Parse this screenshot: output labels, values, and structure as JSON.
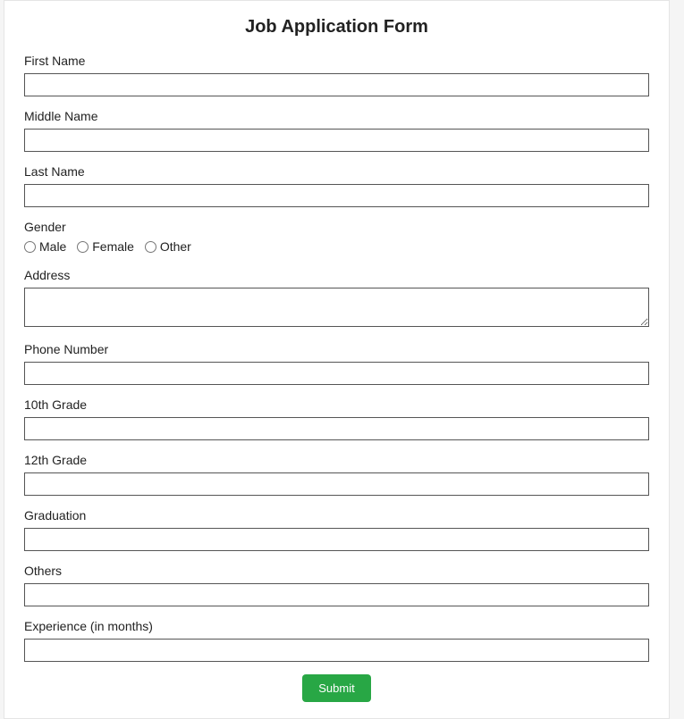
{
  "form": {
    "title": "Job Application Form",
    "firstName": {
      "label": "First Name",
      "value": ""
    },
    "middleName": {
      "label": "Middle Name",
      "value": ""
    },
    "lastName": {
      "label": "Last Name",
      "value": ""
    },
    "gender": {
      "label": "Gender",
      "options": {
        "male": "Male",
        "female": "Female",
        "other": "Other"
      }
    },
    "address": {
      "label": "Address",
      "value": ""
    },
    "phone": {
      "label": "Phone Number",
      "value": ""
    },
    "grade10": {
      "label": "10th Grade",
      "value": ""
    },
    "grade12": {
      "label": "12th Grade",
      "value": ""
    },
    "graduation": {
      "label": "Graduation",
      "value": ""
    },
    "others": {
      "label": "Others",
      "value": ""
    },
    "experience": {
      "label": "Experience (in months)",
      "value": ""
    },
    "submit": "Submit"
  }
}
